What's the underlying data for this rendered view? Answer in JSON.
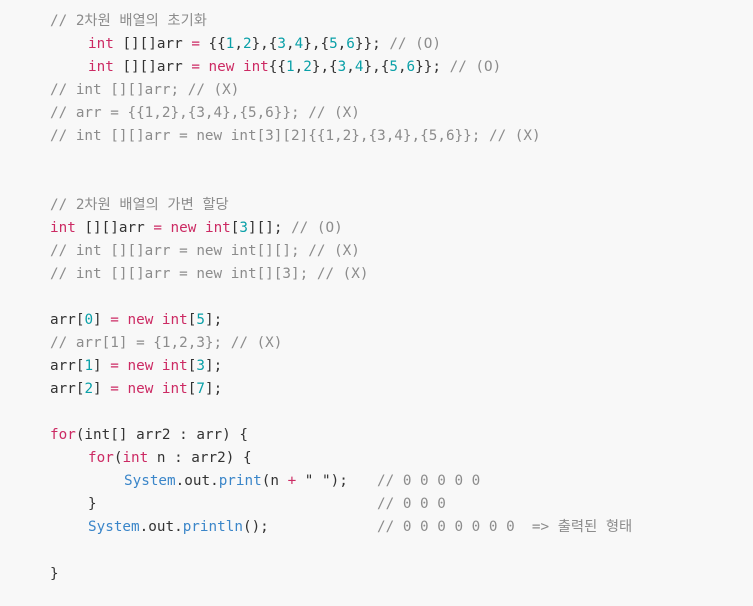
{
  "comments": {
    "section_init": "// 2차원 배열의 초기화",
    "ok": "// (O)",
    "line3": "// int [][]arr; // (X)",
    "line4": "// arr = {{1,2},{3,4},{5,6}}; // (X)",
    "line5": "// int [][]arr = new int[3][2]{{1,2},{3,4},{5,6}}; // (X)",
    "section_var": "// 2차원 배열의 가변 할당",
    "line7": "// (O)",
    "line8": "// int [][]arr = new int[][]; // (X)",
    "line9": "// int [][]arr = new int[][3]; // (X)",
    "line11": "// arr[1] = {1,2,3}; // (X)",
    "out1": "// 0 0 0 0 0",
    "out2": "// 0 0 0",
    "out3": "// 0 0 0 0 0 0 0  => 출력된 형태"
  },
  "tokens": {
    "int": "int",
    "new": "new",
    "for": "for",
    "arr_decl": "[][]arr",
    "eq": "=",
    "lbrace2": "{{",
    "rbrace2": "}};",
    "one": "1",
    "two": "2",
    "three": "3",
    "four": "4",
    "five": "5",
    "six": "6",
    "seven": "7",
    "zero": "0",
    "comma": ",",
    "sep": "},{",
    "arr": "arr",
    "lb": "[",
    "rb": "]",
    "rbsemi": "];",
    "rbrb": "][];",
    "for_head1": "(int[] arr2 : arr) {",
    "for_head2a": "(",
    "for_head2b": " n : arr2) {",
    "system": "System",
    "out": ".out.",
    "print": "print",
    "print_args_a": "(n ",
    "plus": "+",
    "print_args_b": " \" \");",
    "println": "println",
    "println_args": "();",
    "close_inner": "}",
    "close_outer": "}"
  }
}
